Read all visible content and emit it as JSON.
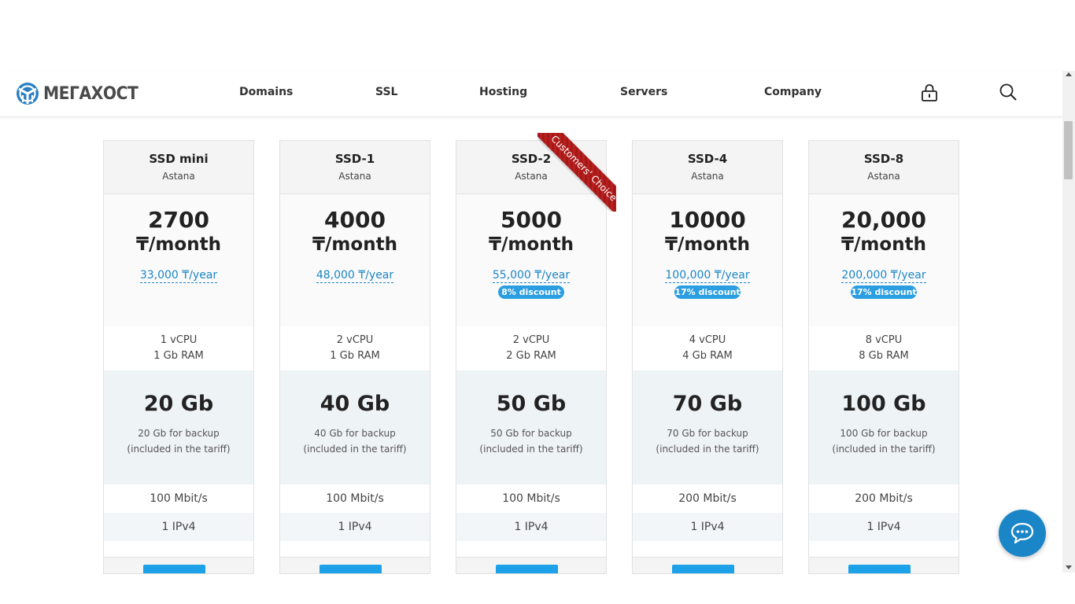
{
  "logo": {
    "text": "МЕГАХОСТ"
  },
  "nav": [
    {
      "label": "Domains"
    },
    {
      "label": "SSL"
    },
    {
      "label": "Hosting"
    },
    {
      "label": "Servers"
    },
    {
      "label": "Company"
    }
  ],
  "icons": {
    "account": "lock-icon",
    "search": "search-icon",
    "chat": "chat-icon"
  },
  "colors": {
    "accent": "#1b86c7",
    "discount": "#2a9ee0",
    "ribbon": "#b81f1f",
    "button": "#1da1e8"
  },
  "ribbon": {
    "text": "Customers' Choice"
  },
  "plans": [
    {
      "name": "SSD mini",
      "location": "Astana",
      "price": "2700",
      "unit": "₸/month",
      "yearly": "33,000 ₸/year",
      "discount": "",
      "cpu": "1 vCPU",
      "ram": "1 Gb RAM",
      "disk": "20 Gb",
      "backup": "20 Gb for backup",
      "backup_note": "(included in the tariff)",
      "speed": "100 Mbit/s",
      "ip": "1 IPv4"
    },
    {
      "name": "SSD-1",
      "location": "Astana",
      "price": "4000",
      "unit": "₸/month",
      "yearly": "48,000 ₸/year",
      "discount": "",
      "cpu": "2 vCPU",
      "ram": "1 Gb RAM",
      "disk": "40 Gb",
      "backup": "40 Gb for backup",
      "backup_note": "(included in the tariff)",
      "speed": "100 Mbit/s",
      "ip": "1 IPv4"
    },
    {
      "name": "SSD-2",
      "location": "Astana",
      "price": "5000",
      "unit": "₸/month",
      "yearly": "55,000 ₸/year",
      "discount": "8% discount",
      "cpu": "2 vCPU",
      "ram": "2 Gb RAM",
      "disk": "50 Gb",
      "backup": "50 Gb for backup",
      "backup_note": "(included in the tariff)",
      "speed": "100 Mbit/s",
      "ip": "1 IPv4"
    },
    {
      "name": "SSD-4",
      "location": "Astana",
      "price": "10000",
      "unit": "₸/month",
      "yearly": "100,000 ₸/year",
      "discount": "17% discount",
      "cpu": "4 vCPU",
      "ram": "4 Gb RAM",
      "disk": "70 Gb",
      "backup": "70 Gb for backup",
      "backup_note": "(included in the tariff)",
      "speed": "200 Mbit/s",
      "ip": "1 IPv4"
    },
    {
      "name": "SSD-8",
      "location": "Astana",
      "price": "20,000",
      "unit": "₸/month",
      "yearly": "200,000 ₸/year",
      "discount": "17% discount",
      "cpu": "8 vCPU",
      "ram": "8 Gb RAM",
      "disk": "100 Gb",
      "backup": "100 Gb for backup",
      "backup_note": "(included in the tariff)",
      "speed": "200 Mbit/s",
      "ip": "1 IPv4"
    }
  ]
}
